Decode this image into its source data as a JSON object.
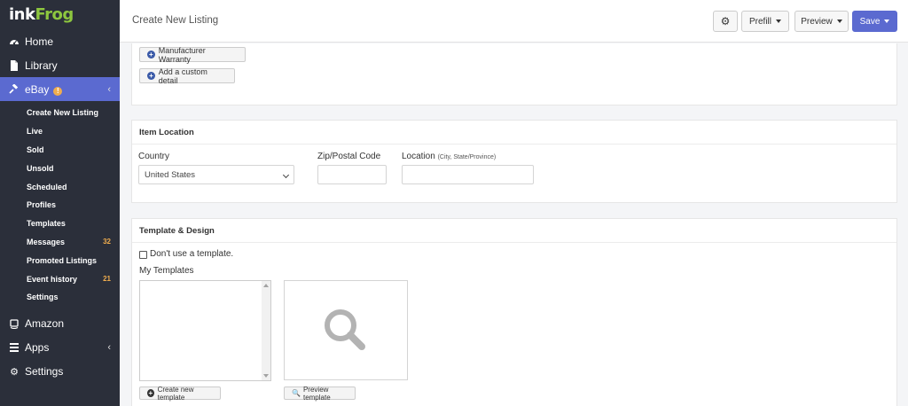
{
  "brand": {
    "name_part1": "ink",
    "name_part2": "Frog"
  },
  "sidebar": {
    "items": [
      {
        "label": "Home",
        "icon": "dashboard-icon"
      },
      {
        "label": "Library",
        "icon": "file-icon"
      },
      {
        "label": "eBay",
        "icon": "gavel-icon",
        "badge": "!"
      },
      {
        "label": "Amazon",
        "icon": "amazon-icon"
      },
      {
        "label": "Apps",
        "icon": "grid-icon"
      },
      {
        "label": "Settings",
        "icon": "gear-icon"
      }
    ],
    "ebay_sub": [
      {
        "label": "Create New Listing",
        "count": ""
      },
      {
        "label": "Live",
        "count": ""
      },
      {
        "label": "Sold",
        "count": ""
      },
      {
        "label": "Unsold",
        "count": ""
      },
      {
        "label": "Scheduled",
        "count": ""
      },
      {
        "label": "Profiles",
        "count": ""
      },
      {
        "label": "Templates",
        "count": ""
      },
      {
        "label": "Messages",
        "count": "32"
      },
      {
        "label": "Promoted Listings",
        "count": ""
      },
      {
        "label": "Event history",
        "count": "21"
      },
      {
        "label": "Settings",
        "count": ""
      }
    ]
  },
  "topbar": {
    "title": "Create New Listing",
    "settings_icon": "gear-icon",
    "prefill_label": "Prefill",
    "preview_label": "Preview",
    "save_label": "Save",
    "accent": "#5b6ad0"
  },
  "details": {
    "manufacturer_warranty_label": "Manufacturer Warranty",
    "add_custom_label": "Add a custom detail"
  },
  "item_location": {
    "heading": "Item Location",
    "country_label": "Country",
    "country_value": "United States",
    "zip_label": "Zip/Postal Code",
    "zip_value": "",
    "location_label": "Location",
    "location_hint": "(City, State/Province)",
    "location_value": ""
  },
  "template_design": {
    "heading": "Template & Design",
    "no_template_label": "Don't use a template.",
    "my_templates_label": "My Templates",
    "create_template_label": "Create new template",
    "preview_template_label": "Preview template"
  }
}
